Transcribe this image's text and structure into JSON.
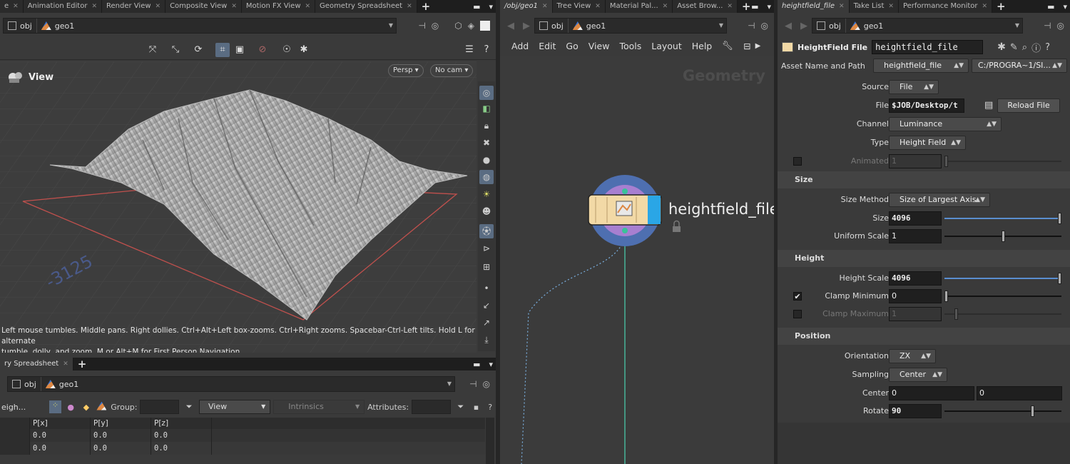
{
  "left_pane": {
    "tabs": [
      {
        "label": "e"
      },
      {
        "label": "Animation Editor"
      },
      {
        "label": "Render View"
      },
      {
        "label": "Composite View"
      },
      {
        "label": "Motion FX View"
      },
      {
        "label": "Geometry Spreadsheet"
      }
    ],
    "path": {
      "root": "obj",
      "node": "geo1"
    },
    "viewport": {
      "title": "View",
      "persp_label": "Persp",
      "cam_label": "No cam",
      "axis_value": "-3125",
      "hint_line1": "Left mouse tumbles. Middle pans. Right dollies. Ctrl+Alt+Left box-zooms. Ctrl+Right zooms. Spacebar-Ctrl-Left tilts. Hold L for alternate",
      "hint_line2": "tumble, dolly, and zoom.   M or Alt+M for First Person Navigation."
    },
    "spreadsheet": {
      "tab_label": "ry Spreadsheet",
      "path": {
        "root": "obj",
        "node": "geo1"
      },
      "node_label": "eigh...",
      "group_label": "Group:",
      "view_label": "View",
      "intrinsics_label": "Intrinsics",
      "attributes_label": "Attributes:",
      "columns": [
        "",
        "P[x]",
        "P[y]",
        "P[z]"
      ],
      "rows": [
        [
          "",
          "0.0",
          "0.0",
          "0.0"
        ],
        [
          "",
          "0.0",
          "0.0",
          "0.0"
        ]
      ]
    }
  },
  "middle_pane": {
    "tabs": [
      {
        "label": "/obj/geo1"
      },
      {
        "label": "Tree View"
      },
      {
        "label": "Material Pal..."
      },
      {
        "label": "Asset Brow..."
      }
    ],
    "path": {
      "root": "obj",
      "node": "geo1"
    },
    "menu": [
      "Add",
      "Edit",
      "Go",
      "View",
      "Tools",
      "Layout",
      "Help"
    ],
    "context_label": "Geometry",
    "node_name": "heightfield_file"
  },
  "right_pane": {
    "tabs": [
      {
        "label": "heightfield_file"
      },
      {
        "label": "Take List"
      },
      {
        "label": "Performance Monitor"
      }
    ],
    "path": {
      "root": "obj",
      "node": "geo1"
    },
    "node_type": "HeightField File",
    "node_name": "heightfield_file",
    "asset_label": "Asset Name and Path",
    "asset_name": "heightfield_file",
    "asset_path": "C:/PROGRA~1/SI...",
    "source": {
      "label": "Source",
      "value": "File"
    },
    "file": {
      "label": "File",
      "value": "$JOB/Desktop/t",
      "reload": "Reload File"
    },
    "channel": {
      "label": "Channel",
      "value": "Luminance"
    },
    "type": {
      "label": "Type",
      "value": "Height Field"
    },
    "animated": {
      "label": "Animated",
      "value": "1",
      "checked": false
    },
    "sections": {
      "size": "Size",
      "height": "Height",
      "position": "Position"
    },
    "size_method": {
      "label": "Size Method",
      "value": "Size of Largest Axis"
    },
    "size": {
      "label": "Size",
      "value": "4096",
      "slider": 1.0
    },
    "uniform_scale": {
      "label": "Uniform Scale",
      "value": "1",
      "slider": 0.5
    },
    "height_scale": {
      "label": "Height Scale",
      "value": "4096",
      "slider": 1.0
    },
    "clamp_min": {
      "label": "Clamp Minimum",
      "value": "0",
      "checked": true,
      "slider": 0.0
    },
    "clamp_max": {
      "label": "Clamp Maximum",
      "value": "1",
      "checked": false,
      "slider": 0.1
    },
    "orientation": {
      "label": "Orientation",
      "value": "ZX"
    },
    "sampling": {
      "label": "Sampling",
      "value": "Center"
    },
    "center": {
      "label": "Center",
      "x": "0",
      "y": "0"
    },
    "rotate": {
      "label": "Rotate",
      "value": "90",
      "slider": 0.75
    }
  },
  "colors": {
    "selection": "#5a6c82",
    "slider_fill": "#5a8ed0",
    "node_color": "#f2d9a6",
    "wire": "#4ac6a8"
  }
}
